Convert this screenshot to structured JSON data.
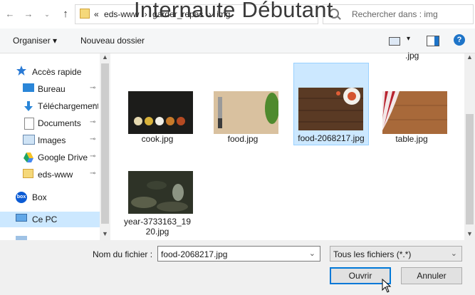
{
  "watermark": "Internaute Débutant",
  "nav_buttons": {
    "up": "↑"
  },
  "address": {
    "overflow": "«",
    "crumbs": [
      "eds-www",
      "›",
      "garder_repas",
      "›",
      "img"
    ]
  },
  "search": {
    "placeholder": "Rechercher dans : img"
  },
  "toolbar": {
    "organize": "Organiser ▾",
    "new_folder": "Nouveau dossier",
    "view": "▾",
    "help": "?"
  },
  "nav": {
    "items": [
      {
        "label": "Accès rapide",
        "icon": "star-icon",
        "pinned": false
      },
      {
        "label": "Bureau",
        "icon": "desktop-icon",
        "pinned": true
      },
      {
        "label": "Téléchargements",
        "icon": "download-icon",
        "pinned": true
      },
      {
        "label": "Documents",
        "icon": "documents-icon",
        "pinned": true
      },
      {
        "label": "Images",
        "icon": "images-icon",
        "pinned": true
      },
      {
        "label": "Google Drive",
        "icon": "google-drive-icon",
        "pinned": true
      },
      {
        "label": "eds-www",
        "icon": "folder-icon",
        "pinned": true
      },
      {
        "label": "Box",
        "icon": "box-icon",
        "pinned": false
      },
      {
        "label": "Ce PC",
        "icon": "computer-icon",
        "pinned": false
      }
    ],
    "pin_glyph": "📌"
  },
  "files": [
    {
      "name": "cook.jpg",
      "selected": false
    },
    {
      "name": "food.jpg",
      "selected": false
    },
    {
      "name": "food-2068217.jpg",
      "selected": true
    },
    {
      "name": "table.jpg",
      "selected": false
    },
    {
      "name": "year-3733163_1920.jpg",
      "selected": false
    }
  ],
  "partial_file": ".jpg",
  "bottom": {
    "filename_label": "Nom du fichier :",
    "filename_value": "food-2068217.jpg",
    "filter_value": "Tous les fichiers (*.*)",
    "open": "Ouvrir",
    "cancel": "Annuler"
  },
  "colors": {
    "selection": "#cce8ff",
    "accent": "#0078d7"
  }
}
